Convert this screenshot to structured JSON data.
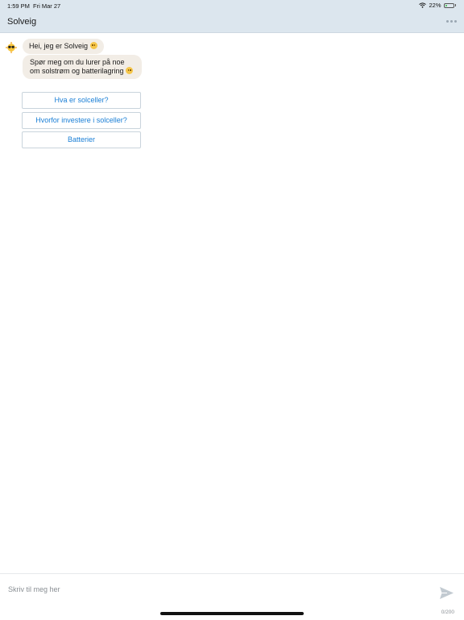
{
  "status_bar": {
    "time": "1:59 PM",
    "date": "Fri Mar 27",
    "battery_percent": "22%",
    "battery_level": 0.22,
    "icons": [
      "wifi-icon",
      "battery-icon"
    ]
  },
  "header": {
    "title": "Solveig",
    "background_color": "#dce6ee",
    "menu_icon": "more-dots-icon"
  },
  "chat": {
    "bot_avatar": "sun-face-avatar",
    "messages": [
      {
        "text": "Hei, jeg er Solveig",
        "emoji": "smiling-face"
      },
      {
        "text": "Spør meg om du lurer på noe om solstrøm og batterilagring",
        "emoji": "smiling-face"
      }
    ],
    "quick_replies": [
      "Hva er solceller?",
      "Hvorfor investere i solceller?",
      "Batterier"
    ],
    "link_color": "#1a7fd6",
    "bubble_color": "#f2ede6"
  },
  "composer": {
    "placeholder": "Skriv til meg her",
    "value": "",
    "counter": "0/200",
    "send_icon": "send-arrow-icon"
  }
}
